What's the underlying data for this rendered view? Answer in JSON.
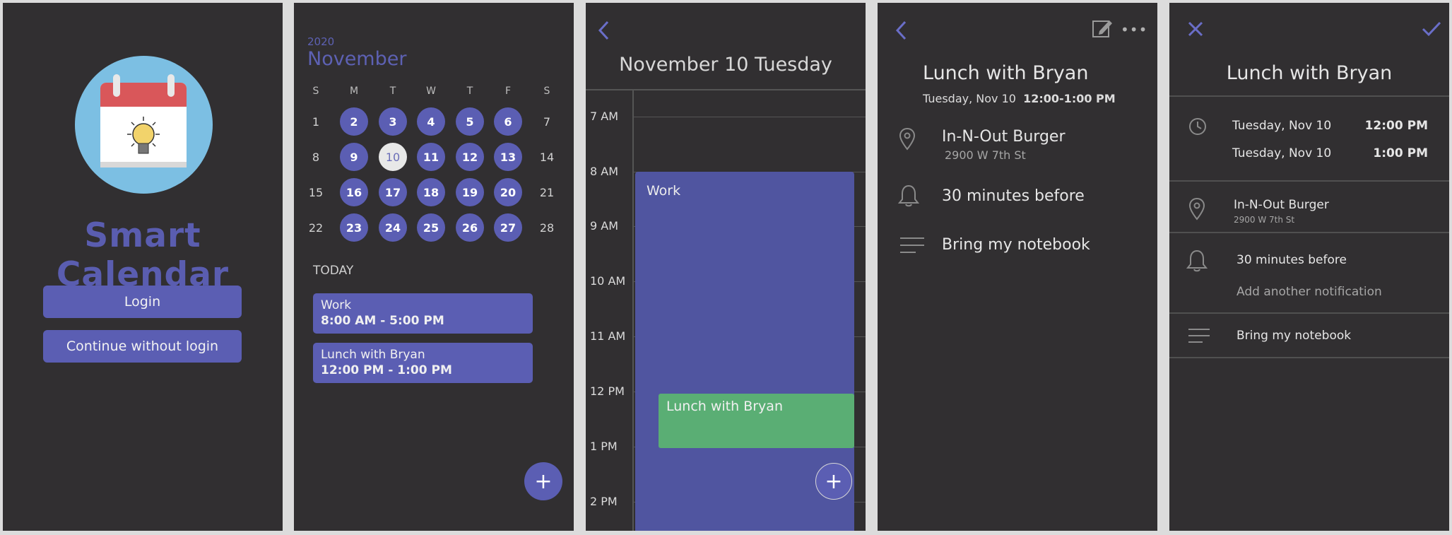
{
  "login": {
    "app_title": "Smart Calendar",
    "login_label": "Login",
    "guest_label": "Continue without login"
  },
  "month_view": {
    "year": "2020",
    "month": "November",
    "weekdays": [
      "S",
      "M",
      "T",
      "W",
      "T",
      "F",
      "S"
    ],
    "weeks": [
      [
        "1",
        "2",
        "3",
        "4",
        "5",
        "6",
        "7"
      ],
      [
        "8",
        "9",
        "10",
        "11",
        "12",
        "13",
        "14"
      ],
      [
        "15",
        "16",
        "17",
        "18",
        "19",
        "20",
        "21"
      ],
      [
        "22",
        "23",
        "24",
        "25",
        "26",
        "27",
        "28"
      ]
    ],
    "today_label": "TODAY",
    "events": [
      {
        "title": "Work",
        "time": "8:00 AM - 5:00 PM"
      },
      {
        "title": "Lunch with Bryan",
        "time": "12:00 PM - 1:00 PM"
      }
    ],
    "fab_label": "+"
  },
  "day_view": {
    "date_title": "November  10  Tuesday",
    "hours": [
      "7 AM",
      "8 AM",
      "9 AM",
      "10 AM",
      "11 AM",
      "12 PM",
      "1 PM",
      "2 PM"
    ],
    "events": [
      {
        "title": "Work",
        "color": "#5055a0"
      },
      {
        "title": "Lunch with Bryan",
        "color": "#5aae74"
      }
    ],
    "fab_label": "+"
  },
  "event_detail": {
    "title": "Lunch with Bryan",
    "date": "Tuesday, Nov 10",
    "time": "12:00-1:00 PM",
    "location_name": "In-N-Out Burger",
    "location_address": "2900 W 7th St",
    "reminder": "30 minutes before",
    "note": "Bring my notebook"
  },
  "event_edit": {
    "title": "Lunch with Bryan",
    "start_date": "Tuesday, Nov 10",
    "start_time": "12:00 PM",
    "end_date": "Tuesday, Nov 10",
    "end_time": "1:00 PM",
    "location_name": "In-N-Out Burger",
    "location_address": "2900 W 7th St",
    "reminder": "30 minutes before",
    "add_notification": "Add another notification",
    "note": "Bring my notebook"
  },
  "colors": {
    "accent": "#5b5eb3",
    "background": "#312f31",
    "lunch_event": "#5aae74"
  }
}
